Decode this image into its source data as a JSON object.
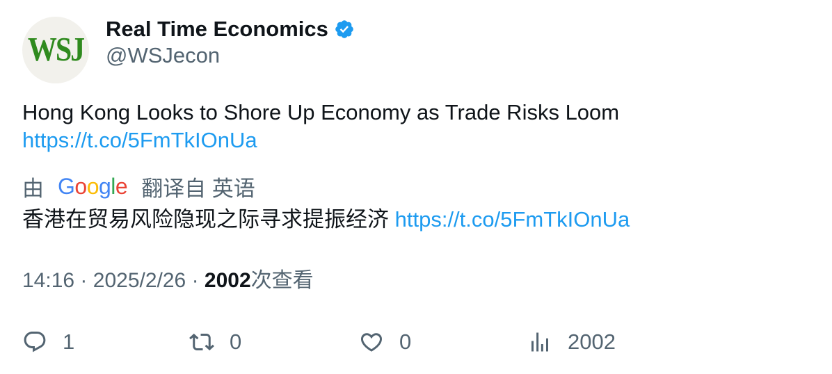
{
  "author": {
    "avatar_text": "WSJ",
    "display_name": "Real Time Economics",
    "handle": "@WSJecon",
    "verified_icon": "verified-badge-icon"
  },
  "tweet": {
    "text": "Hong Kong Looks to Shore Up Economy as Trade Risks Loom",
    "link": "https://t.co/5FmTkIOnUa"
  },
  "translation": {
    "prefix": "由",
    "provider_logo": {
      "g1": "G",
      "o1": "o",
      "o2": "o",
      "g2": "g",
      "l": "l",
      "e": "e"
    },
    "suffix": "翻译自 英语",
    "text": "香港在贸易风险隐现之际寻求提振经济",
    "link": "https://t.co/5FmTkIOnUa"
  },
  "meta": {
    "time": "14:16",
    "sep1": "·",
    "date": "2025/2/26",
    "sep2": "·",
    "views_count": "2002",
    "views_label": "次查看"
  },
  "actions": {
    "reply": {
      "icon": "reply-icon",
      "count": "1"
    },
    "retweet": {
      "icon": "retweet-icon",
      "count": "0"
    },
    "like": {
      "icon": "heart-icon",
      "count": "0"
    },
    "views": {
      "icon": "analytics-icon",
      "count": "2002"
    }
  },
  "colors": {
    "link": "#1d9bf0",
    "secondary_text": "#536471",
    "primary_text": "#0f1419",
    "verified": "#1d9bf0",
    "avatar_bg": "#f2f1ec",
    "avatar_text": "#2f8a1e"
  }
}
